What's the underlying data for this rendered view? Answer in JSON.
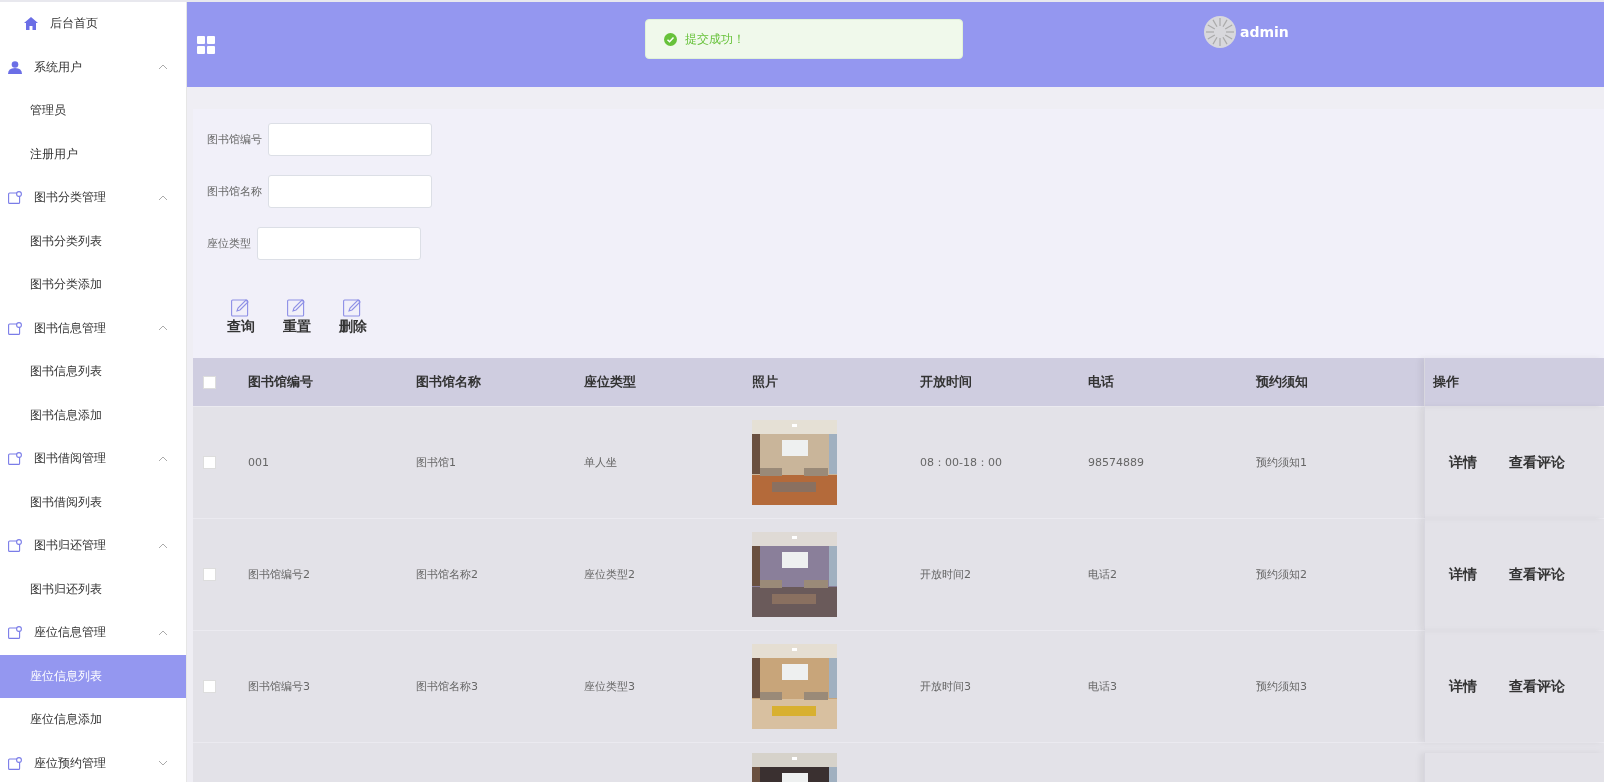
{
  "sidebar": {
    "items": [
      {
        "label": "后台首页",
        "kind": "home"
      },
      {
        "label": "系统用户",
        "kind": "user",
        "expanded": true,
        "children": [
          {
            "label": "管理员",
            "selected": false
          },
          {
            "label": "注册用户",
            "selected": false
          }
        ]
      },
      {
        "label": "图书分类管理",
        "kind": "module",
        "expanded": true,
        "children": [
          {
            "label": "图书分类列表",
            "selected": false
          },
          {
            "label": "图书分类添加",
            "selected": false
          }
        ]
      },
      {
        "label": "图书信息管理",
        "kind": "module",
        "expanded": true,
        "children": [
          {
            "label": "图书信息列表",
            "selected": false
          },
          {
            "label": "图书信息添加",
            "selected": false
          }
        ]
      },
      {
        "label": "图书借阅管理",
        "kind": "module",
        "expanded": true,
        "children": [
          {
            "label": "图书借阅列表",
            "selected": false
          }
        ]
      },
      {
        "label": "图书归还管理",
        "kind": "module",
        "expanded": true,
        "children": [
          {
            "label": "图书归还列表",
            "selected": false
          }
        ]
      },
      {
        "label": "座位信息管理",
        "kind": "module",
        "expanded": true,
        "children": [
          {
            "label": "座位信息列表",
            "selected": true
          },
          {
            "label": "座位信息添加",
            "selected": false
          }
        ]
      },
      {
        "label": "座位预约管理",
        "kind": "module",
        "expanded": false
      }
    ]
  },
  "header": {
    "toast": "提交成功！",
    "user": "admin"
  },
  "search": {
    "fields": [
      {
        "label": "图书馆编号"
      },
      {
        "label": "图书馆名称"
      },
      {
        "label": "座位类型"
      }
    ],
    "buttons": [
      "查询",
      "重置",
      "删除"
    ]
  },
  "table": {
    "columns": [
      "图书馆编号",
      "图书馆名称",
      "座位类型",
      "照片",
      "开放时间",
      "电话",
      "预约须知"
    ],
    "action_column": "操作",
    "all_checked": false,
    "rows": [
      {
        "checked": false,
        "cells": [
          "001",
          "图书馆1",
          "单人坐",
          null,
          "08：00-18：00",
          "98574889",
          "预约须知1"
        ],
        "photo": {
          "kind": "picture"
        },
        "actions": [
          "详情",
          "查看评论"
        ]
      },
      {
        "checked": false,
        "cells": [
          "图书馆编号2",
          "图书馆名称2",
          "座位类型2",
          null,
          "开放时间2",
          "电话2",
          "预约须知2"
        ],
        "photo": {
          "kind": "picture"
        },
        "actions": [
          "详情",
          "查看评论"
        ]
      },
      {
        "checked": false,
        "cells": [
          "图书馆编号3",
          "图书馆名称3",
          "座位类型3",
          null,
          "开放时间3",
          "电话3",
          "预约须知3"
        ],
        "photo": {
          "kind": "picture"
        },
        "actions": [
          "详情",
          "查看评论"
        ]
      },
      {
        "photo": {
          "kind": "picture"
        }
      }
    ]
  }
}
